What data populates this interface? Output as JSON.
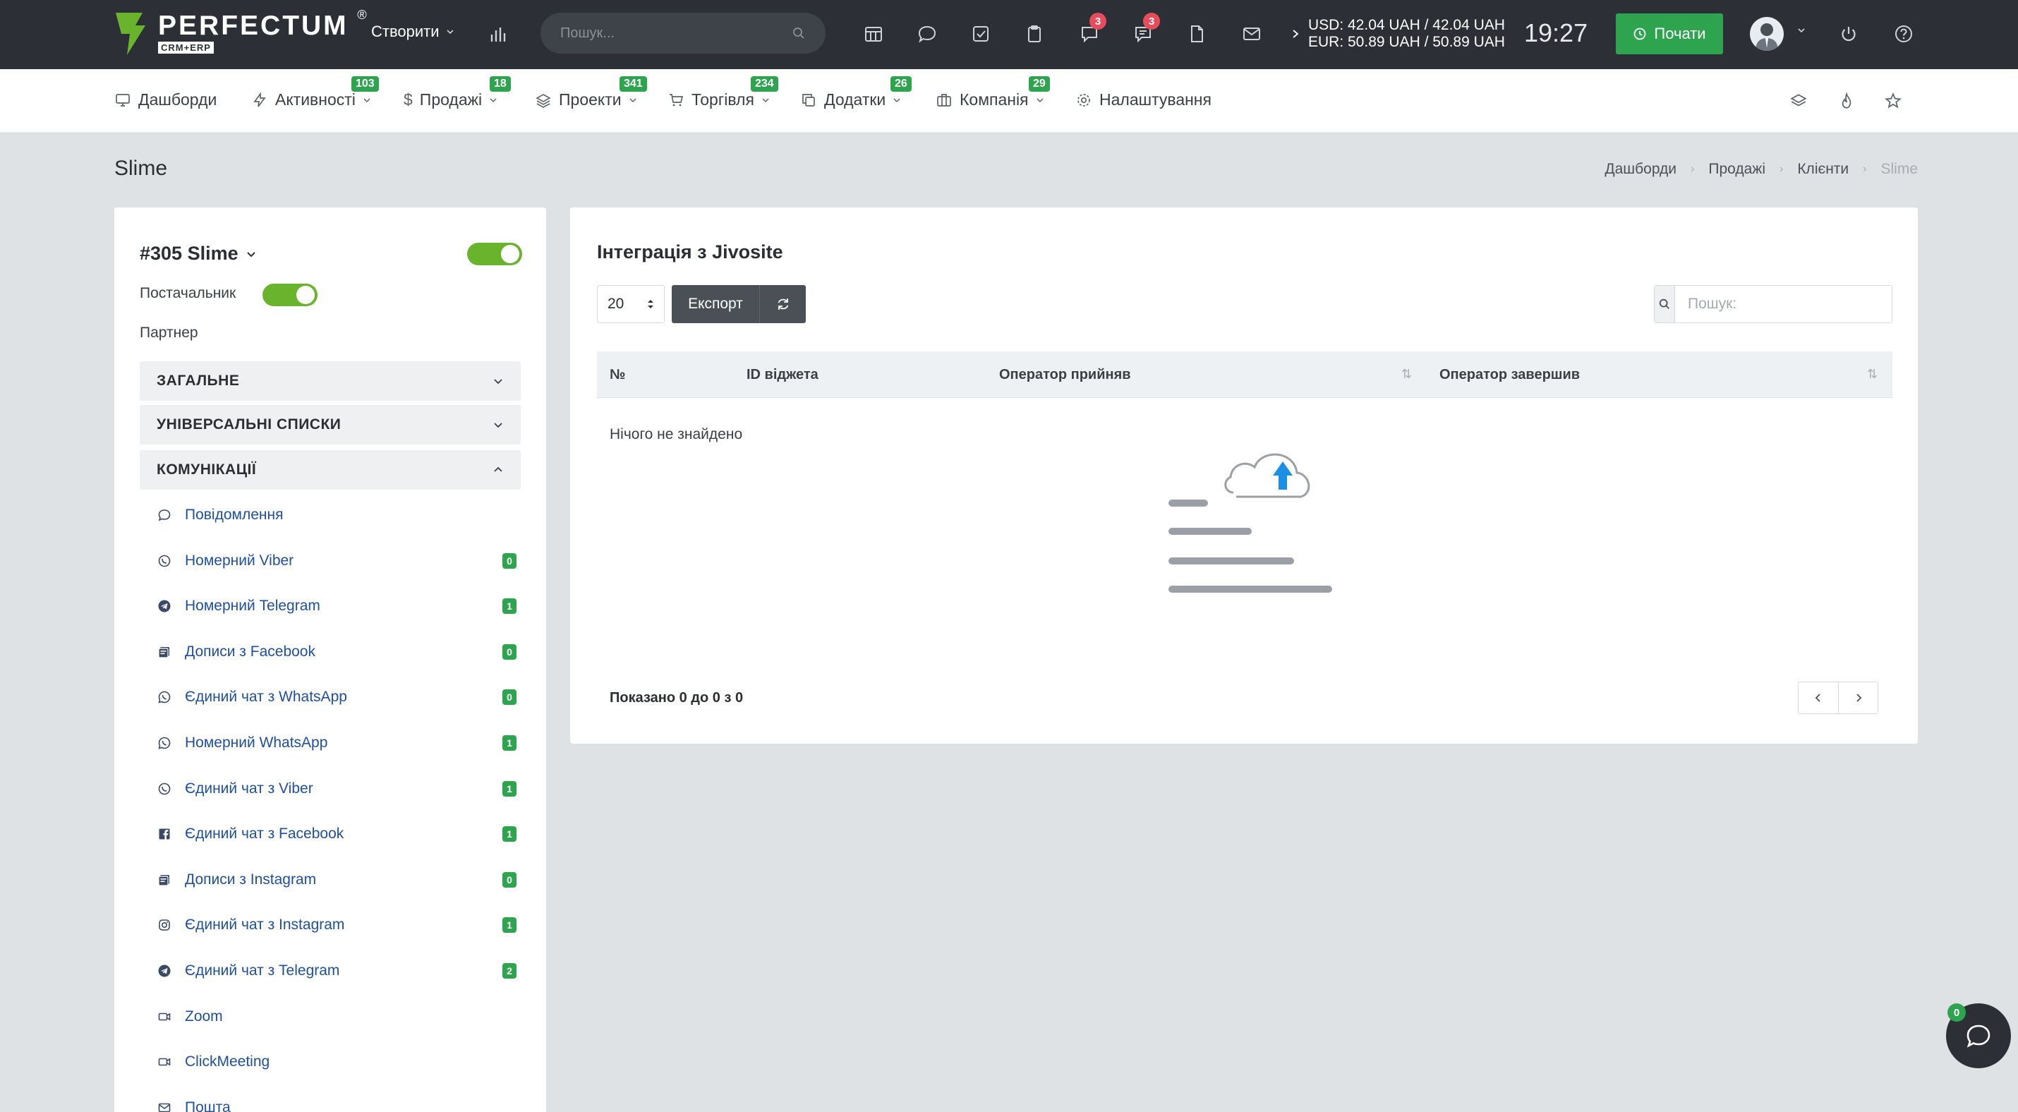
{
  "topbar": {
    "logo_name": "PERFECTUM",
    "logo_reg": "®",
    "logo_sub": "CRM+ERP",
    "create_label": "Створити",
    "search_placeholder": "Пошук...",
    "notif_badge_1": "3",
    "notif_badge_2": "3",
    "rate_usd": "USD: 42.04 UAH / 42.04 UAH",
    "rate_eur": "EUR: 50.89 UAH / 50.89 UAH",
    "clock": "19:27",
    "start_label": "Почати"
  },
  "nav": {
    "items": [
      {
        "label": "Дашборди",
        "badge": ""
      },
      {
        "label": "Активності",
        "badge": "103"
      },
      {
        "label": "Продажі",
        "badge": "18"
      },
      {
        "label": "Проекти",
        "badge": "341"
      },
      {
        "label": "Торгівля",
        "badge": "234"
      },
      {
        "label": "Додатки",
        "badge": "26"
      },
      {
        "label": "Компанія",
        "badge": "29"
      },
      {
        "label": "Налаштування",
        "badge": ""
      }
    ]
  },
  "page": {
    "title": "Slime",
    "breadcrumb": [
      "Дашборди",
      "Продажі",
      "Клієнти",
      "Slime"
    ]
  },
  "client": {
    "header": "#305 Slime",
    "supplier_label": "Постачальник",
    "partner_label": "Партнер",
    "sections": [
      "ЗАГАЛЬНЕ",
      "УНІВЕРСАЛЬНІ СПИСКИ",
      "КОМУНІКАЦІЇ"
    ],
    "comms": [
      {
        "label": "Повідомлення",
        "badge": "",
        "icon": "chat-bubble-icon"
      },
      {
        "label": "Номерний Viber",
        "badge": "0",
        "icon": "viber-icon"
      },
      {
        "label": "Номерний Telegram",
        "badge": "1",
        "icon": "telegram-icon"
      },
      {
        "label": "Дописи з Facebook",
        "badge": "0",
        "icon": "posts-icon"
      },
      {
        "label": "Єдиний чат з WhatsApp",
        "badge": "0",
        "icon": "whatsapp-icon"
      },
      {
        "label": "Номерний WhatsApp",
        "badge": "1",
        "icon": "whatsapp-icon"
      },
      {
        "label": "Єдиний чат з Viber",
        "badge": "1",
        "icon": "viber-icon"
      },
      {
        "label": "Єдиний чат з Facebook",
        "badge": "1",
        "icon": "facebook-icon"
      },
      {
        "label": "Дописи з Instagram",
        "badge": "0",
        "icon": "posts-icon"
      },
      {
        "label": "Єдиний чат з Instagram",
        "badge": "1",
        "icon": "instagram-icon"
      },
      {
        "label": "Єдиний чат з Telegram",
        "badge": "2",
        "icon": "telegram-icon"
      },
      {
        "label": "Zoom",
        "badge": "",
        "icon": "video-icon"
      },
      {
        "label": "ClickMeeting",
        "badge": "",
        "icon": "video-icon"
      },
      {
        "label": "Пошта",
        "badge": "",
        "icon": "mail-icon"
      }
    ]
  },
  "table": {
    "title": "Інтеграція з Jivosite",
    "page_size": "20",
    "export_label": "Експорт",
    "search_placeholder": "Пошук:",
    "columns": [
      "№",
      "ID віджета",
      "Оператор прийняв",
      "Оператор завершив"
    ],
    "empty_text": "Нічого не знайдено",
    "shown_text": "Показано 0 до 0 з 0"
  },
  "chat": {
    "badge": "0"
  },
  "colors": {
    "topbar": "#2c3036",
    "accent_green": "#2ea44f",
    "toggle_green": "#6ab42d",
    "badge_red": "#e64c5c",
    "link_blue": "#1f4fa0"
  }
}
